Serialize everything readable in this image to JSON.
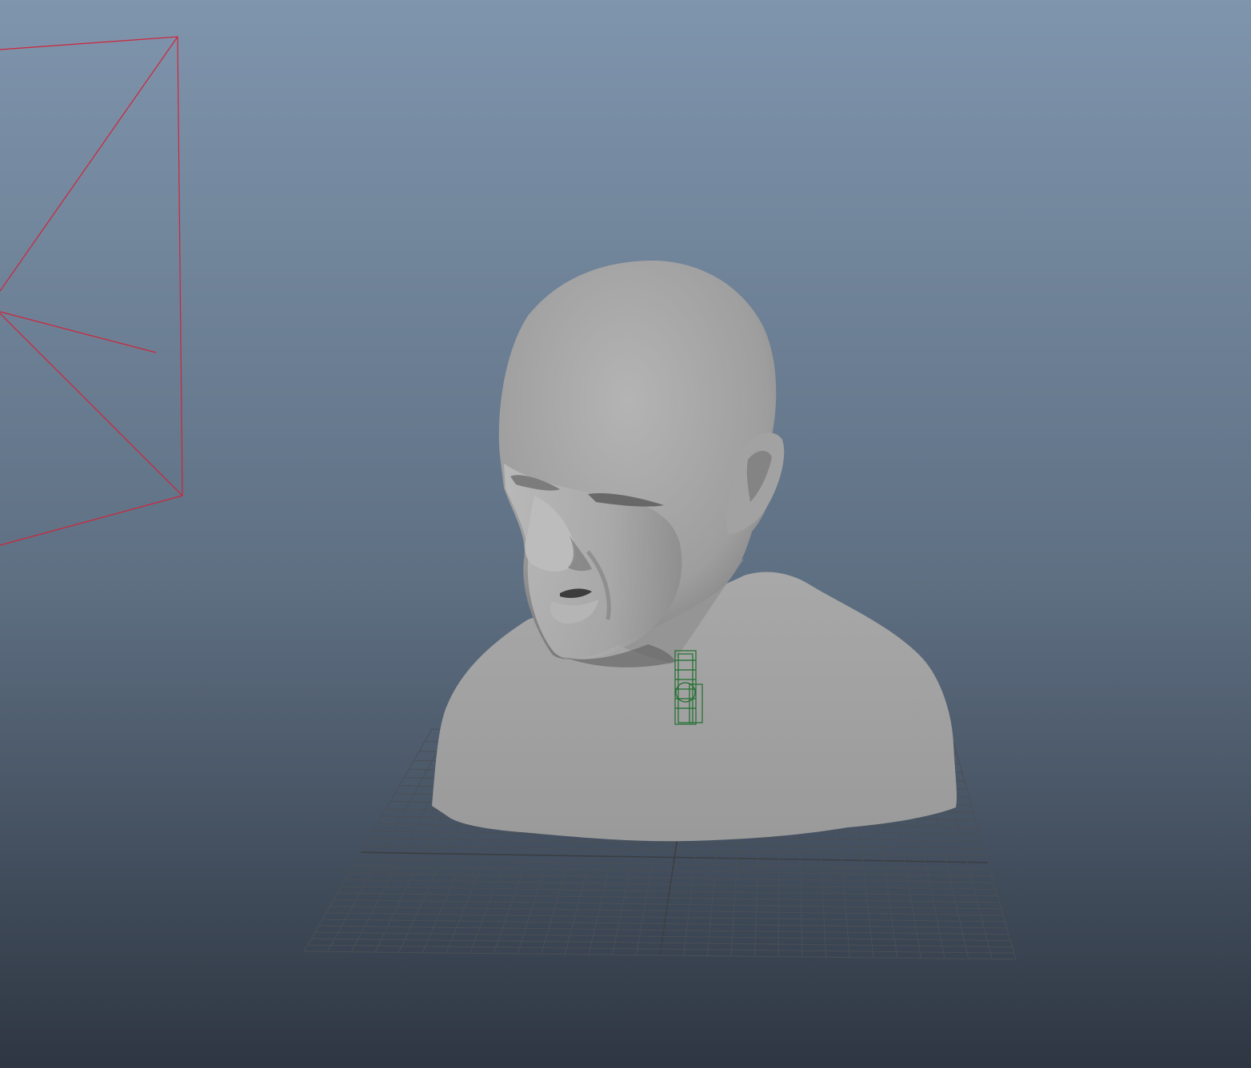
{
  "viewport": {
    "background_top": "#7f95ad",
    "background_mid": "#5e6f82",
    "background_bottom": "#2e3642"
  },
  "scene": {
    "grid_color": "#4b4f55",
    "grid_axis_color": "#3b3e43",
    "mesh_color": "#a6a6a6",
    "mesh_shadow": "#5a5a5a",
    "camera_color": "#d0243a",
    "joint_color": "#1f6e2e",
    "objects": [
      {
        "name": "camera-frustum",
        "kind": "camera"
      },
      {
        "name": "ground-grid",
        "kind": "grid"
      },
      {
        "name": "head-bust-mesh",
        "kind": "mesh"
      },
      {
        "name": "neck-joint-rig",
        "kind": "joint"
      }
    ]
  }
}
